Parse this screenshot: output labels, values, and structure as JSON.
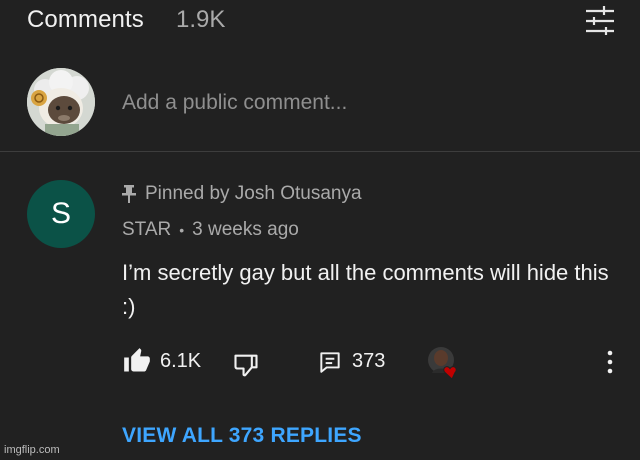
{
  "header": {
    "title": "Comments",
    "count": "1.9K",
    "sort_icon": "sort-sliders-icon"
  },
  "add_comment": {
    "placeholder": "Add a public comment...",
    "avatar_icon": "sheep-avatar"
  },
  "comment": {
    "avatar_letter": "S",
    "avatar_color": "#0b5247",
    "pinned_label": "Pinned by Josh Otusanya",
    "author": "STAR",
    "separator": "•",
    "time": "3 weeks ago",
    "text": "I’m secretly gay but all the comments will hide this :)",
    "likes": "6.1K",
    "replies": "373",
    "creator_heart_color": "#c00000",
    "view_replies_label": "VIEW ALL 373 REPLIES"
  },
  "colors": {
    "background": "#212121",
    "link": "#3ea6ff",
    "secondary_text": "#aaaaaa"
  },
  "watermark": "imgflip.com"
}
